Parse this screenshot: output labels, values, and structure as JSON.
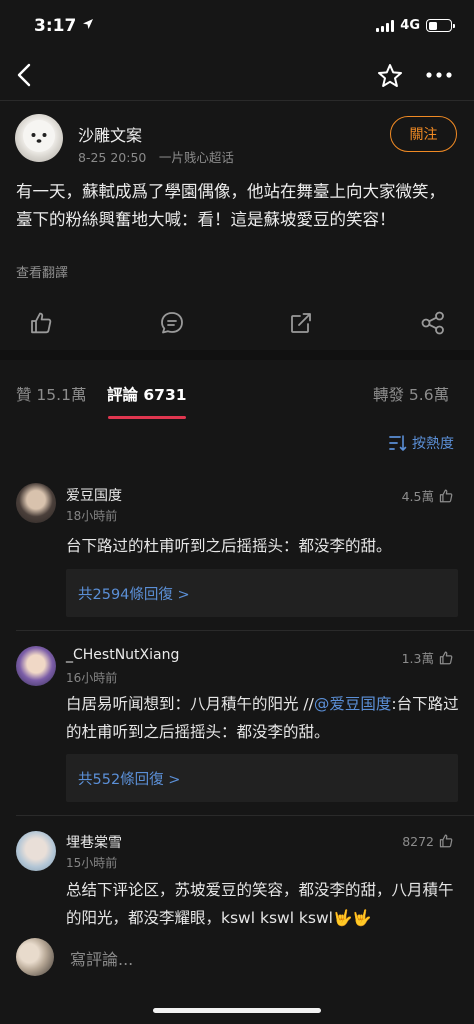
{
  "status": {
    "time": "3:17",
    "network": "4G"
  },
  "post": {
    "author": "沙雕文案",
    "meta": "8-25 20:50　一片贱心超话",
    "follow_label": "關注",
    "text": "有一天，蘇軾成爲了學園偶像，他站在舞臺上向大家微笑，臺下的粉絲興奮地大喊：看！這是蘇坡愛豆的笑容！",
    "translate_label": "查看翻譯"
  },
  "tabs": {
    "likes": "贊 15.1萬",
    "comments": "評論 6731",
    "reposts": "轉發 5.6萬"
  },
  "sort_label": "按熱度",
  "comments": [
    {
      "name": "爱豆国度",
      "time": "18小時前",
      "likes": "4.5萬",
      "text": "台下路过的杜甫听到之后摇摇头：都没李的甜。",
      "replies": "共2594條回復 >"
    },
    {
      "name": "_CHestNutXiang",
      "time": "16小時前",
      "likes": "1.3萬",
      "text_before": "白居易听闻想到：八月積午的阳光 //",
      "mention": "@爱豆国度",
      "text_after": ":台下路过的杜甫听到之后摇摇头：都没李的甜。",
      "replies": "共552條回復 >"
    },
    {
      "name": "埋巷棠雪",
      "time": "15小時前",
      "likes": "8272",
      "text": "总结下评论区，苏坡爱豆的笑容，都没李的甜，八月積午的阳光，都没李耀眼，kswl kswl kswl🤟🤟"
    }
  ],
  "input_placeholder": "寫評論..."
}
